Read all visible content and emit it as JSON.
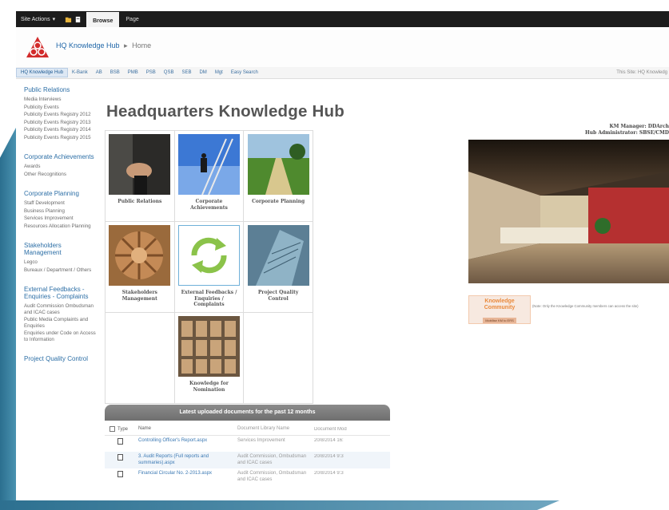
{
  "ribbon": {
    "site_actions": "Site Actions",
    "tabs": [
      {
        "label": "Browse"
      },
      {
        "label": "Page"
      }
    ]
  },
  "header": {
    "site_title": "HQ Knowledge Hub",
    "separator": "▸",
    "current_page": "Home"
  },
  "topnav": {
    "items": [
      {
        "label": "HQ Knowledge Hub"
      },
      {
        "label": "K-Bank"
      },
      {
        "label": "AB"
      },
      {
        "label": "BSB"
      },
      {
        "label": "PMB"
      },
      {
        "label": "PSB"
      },
      {
        "label": "QSB"
      },
      {
        "label": "SEB"
      },
      {
        "label": "DM"
      },
      {
        "label": "Mgt"
      },
      {
        "label": "Easy Search"
      }
    ],
    "this_site": "This Site: HQ Knowledg"
  },
  "leftnav": {
    "sections": [
      {
        "heading": "Public Relations",
        "items": [
          "Media Interviews",
          "Publicity Events",
          "Publicity Events Registry 2012",
          "Publicity Events Registry 2013",
          "Publicity Events Registry 2014",
          "Publicity Events Registry 2015"
        ]
      },
      {
        "heading": "Corporate Achievements",
        "items": [
          "Awards",
          "Other Recognitions"
        ]
      },
      {
        "heading": "Corporate Planning",
        "items": [
          "Staff Development",
          "Business Planning",
          "Services Improvement",
          "Resources Allocation Planning"
        ]
      },
      {
        "heading": "Stakeholders Management",
        "items": [
          "Legco",
          "Bureaux / Department / Others"
        ]
      },
      {
        "heading": "External Feedbacks - Enquiries - Complaints",
        "items": [
          "Audit Commission Ombudsman and ICAC cases",
          "Public Media Complaints and Enquiries",
          "Enquiries under Code on Access to Information"
        ]
      },
      {
        "heading": "Project Quality Control",
        "items": []
      }
    ]
  },
  "page_title": "Headquarters Knowledge Hub",
  "tiles": [
    {
      "caption": "Public Relations"
    },
    {
      "caption": "Corporate Achievements"
    },
    {
      "caption": "Corporate Planning"
    },
    {
      "caption": "Stakeholders Management"
    },
    {
      "caption": "External Feedbacks / Enquiries / Complaints"
    },
    {
      "caption": "Project Quality Control"
    },
    {
      "caption": "Knowledge for Nomination"
    }
  ],
  "documents": {
    "title": "Latest uploaded documents for the past 12 months",
    "columns": [
      "Type",
      "Name",
      "Document Library Name",
      "Document Mod"
    ],
    "rows": [
      {
        "name": "Controlling Officer's Report.aspx",
        "library": "Services Improvement",
        "date": "20/8/2014 16:"
      },
      {
        "name": "3. Audit Reports (Full reports and summaries).aspx",
        "library": "Audit Commission, Ombudsman and ICAC cases",
        "date": "20/8/2014 9:3"
      },
      {
        "name": "Financial Circular No. 2-2013.aspx",
        "library": "Audit Commission, Ombudsman and ICAC cases",
        "date": "20/8/2014 9:3"
      }
    ]
  },
  "managers": {
    "km_manager": "KM Manager: DDArch",
    "hub_admin": "Hub Administrator: SBSE/CMD"
  },
  "kc": {
    "title": "Knowledge Community",
    "button": "Mobilise KM to ERS",
    "note": "(Note: Only the Knowledge Community members can access the site)"
  },
  "colors": {
    "link": "#2d6fa6",
    "ribbon": "#1c1c1c",
    "frame": "#2b6f8f"
  }
}
